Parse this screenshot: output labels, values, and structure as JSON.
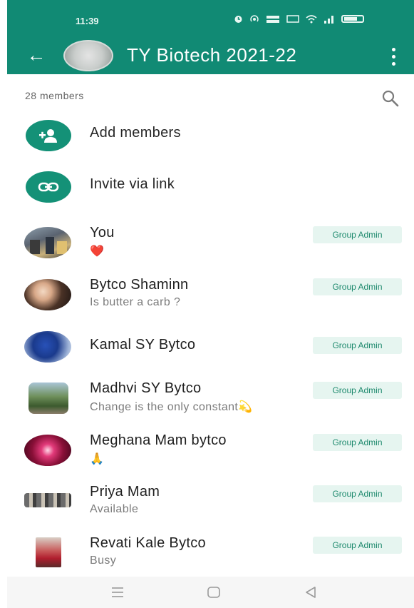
{
  "status_bar": {
    "time": "11:39",
    "indicators": [
      "alarm-icon",
      "hotspot-icon",
      "data-speed-icon",
      "volte-icon",
      "wifi-icon",
      "signal-icon",
      "battery-icon"
    ]
  },
  "header": {
    "title": "TY Biotech 2021-22",
    "background_color": "#118a74"
  },
  "members_count": "28 members",
  "actions": [
    {
      "label": "Add members",
      "icon": "add-person-icon"
    },
    {
      "label": "Invite via link",
      "icon": "link-icon"
    }
  ],
  "badge_label": "Group Admin",
  "members": [
    {
      "name": "You",
      "status": "❤️",
      "admin": true
    },
    {
      "name": "Bytco Shaminn",
      "status": "Is butter a carb ?",
      "admin": true
    },
    {
      "name": "Kamal SY Bytco",
      "status": "",
      "admin": true
    },
    {
      "name": "Madhvi SY Bytco",
      "status": "Change is the only constant💫",
      "admin": true
    },
    {
      "name": "Meghana Mam bytco",
      "status": "🙏",
      "admin": true
    },
    {
      "name": "Priya Mam",
      "status": "Available",
      "admin": true
    },
    {
      "name": "Revati Kale Bytco",
      "status": "Busy",
      "admin": true
    }
  ],
  "nav_bar": [
    "recents-icon",
    "home-icon",
    "back-triangle-icon"
  ]
}
